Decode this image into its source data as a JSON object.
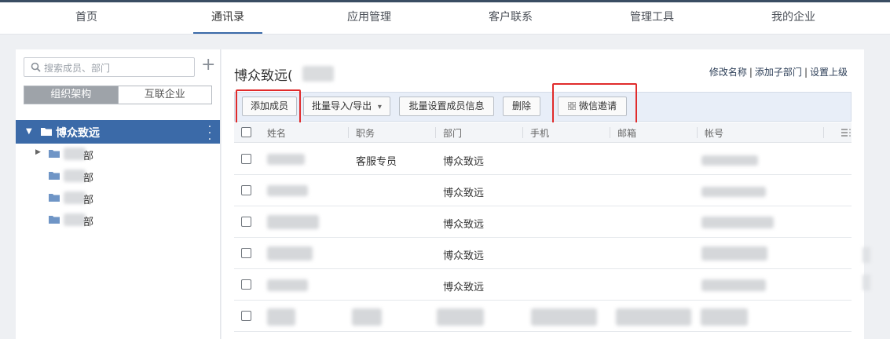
{
  "nav": {
    "items": [
      {
        "label": "首页"
      },
      {
        "label": "通讯录"
      },
      {
        "label": "应用管理"
      },
      {
        "label": "客户联系"
      },
      {
        "label": "管理工具"
      },
      {
        "label": "我的企业"
      }
    ],
    "active": "通讯录"
  },
  "sidebar": {
    "search_placeholder": "搜索成员、部门",
    "tabs": [
      "组织架构",
      "互联企业"
    ],
    "active_tab": "组织架构",
    "root": "博众致远",
    "children": [
      "部",
      "部",
      "部",
      "部"
    ]
  },
  "main": {
    "title": "博众致远(",
    "links": [
      "修改名称",
      "添加子部门",
      "设置上级"
    ],
    "toolbar": {
      "add_member": "添加成员",
      "batch_import": "批量导入/导出",
      "batch_import_caret": "▾",
      "batch_set": "批量设置成员信息",
      "delete": "删除",
      "wechat_invite": "微信邀请"
    },
    "columns": [
      "姓名",
      "职务",
      "部门",
      "手机",
      "邮箱",
      "帐号"
    ],
    "rows": [
      {
        "position": "客服专员",
        "department": "博众致远"
      },
      {
        "position": "",
        "department": "博众致远"
      },
      {
        "position": "",
        "department": "博众致远"
      },
      {
        "position": "",
        "department": "博众致远"
      },
      {
        "position": "",
        "department": "博众致远"
      }
    ]
  },
  "colors": {
    "accent": "#3b6aa8",
    "highlight_box": "#e02b2b",
    "toolbar_bg": "#e8eef8"
  }
}
